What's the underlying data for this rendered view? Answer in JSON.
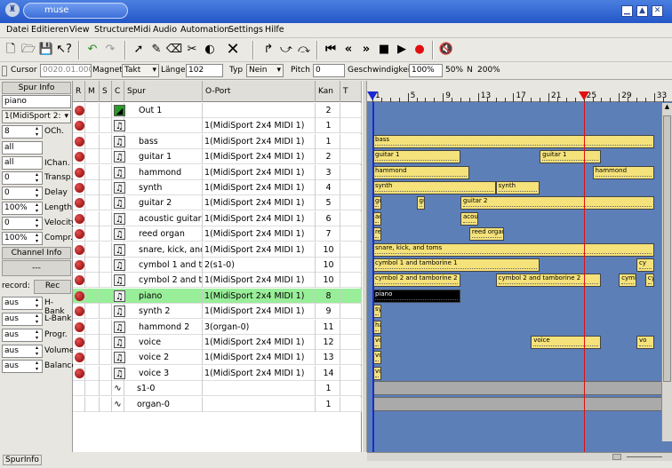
{
  "window": {
    "title": "muse",
    "icon": "muse-icon"
  },
  "menu": [
    "Datei",
    "Editieren",
    "View",
    "Structure",
    "Midi",
    "Audio",
    "Automation",
    "Settings",
    "Hilfe"
  ],
  "toolbar2": {
    "cursor_label": "Cursor",
    "cursor_value": "0020.01.000",
    "magnet_label": "Magnet",
    "magnet_value": "Takt",
    "length_label": "Länge",
    "length_value": "102",
    "type_label": "Typ",
    "type_value": "Nein",
    "pitch_label": "Pitch",
    "pitch_value": "0",
    "speed_label": "Geschwindigkeit",
    "speed_value": "100%",
    "speed_fixed": "50%",
    "n_label": "N",
    "n_value": "200%"
  },
  "left": {
    "spur_info": "Spur Info",
    "track_name": "piano",
    "port": "1(MidiSport 2:",
    "channel": "8",
    "channel_label": "OCh.",
    "input_a": "all",
    "input_b": "all",
    "ichan_label": "IChan.",
    "transp": "0",
    "transp_label": "Transp.",
    "delay": "0",
    "delay_label": "Delay",
    "length": "100%",
    "length_label": "Length",
    "velocity": "0",
    "velocity_label": "Velocity",
    "compr": "100%",
    "compr_label": "Compr.",
    "channel_info": "Channel Info",
    "dashes": "---",
    "record_label": "record:",
    "rec_btn": "Rec",
    "hbank": "aus",
    "hbank_label": "H-Bank",
    "lbank": "aus",
    "lbank_label": "L-Bank",
    "progr": "aus",
    "progr_label": "Progr.",
    "volume": "aus",
    "volume_label": "Volume",
    "balance": "aus",
    "balance_label": "Balance",
    "status": "SpurInfo"
  },
  "tracklist": {
    "headers": [
      "R",
      "M",
      "S",
      "C",
      "Spur",
      "O-Port",
      "Kan",
      "T"
    ],
    "rows": [
      {
        "name": "Out 1",
        "port": "",
        "ch": "2",
        "type": "out"
      },
      {
        "name": "",
        "port": "1(MidiSport 2x4 MIDI 1)",
        "ch": "1",
        "type": "midi"
      },
      {
        "name": "bass",
        "port": "1(MidiSport 2x4 MIDI 1)",
        "ch": "1",
        "type": "midi"
      },
      {
        "name": "guitar 1",
        "port": "1(MidiSport 2x4 MIDI 1)",
        "ch": "2",
        "type": "midi"
      },
      {
        "name": "hammond",
        "port": "1(MidiSport 2x4 MIDI 1)",
        "ch": "3",
        "type": "midi"
      },
      {
        "name": "synth",
        "port": "1(MidiSport 2x4 MIDI 1)",
        "ch": "4",
        "type": "midi"
      },
      {
        "name": "guitar 2",
        "port": "1(MidiSport 2x4 MIDI 1)",
        "ch": "5",
        "type": "midi"
      },
      {
        "name": "acoustic guitar",
        "port": "1(MidiSport 2x4 MIDI 1)",
        "ch": "6",
        "type": "midi"
      },
      {
        "name": "reed organ",
        "port": "1(MidiSport 2x4 MIDI 1)",
        "ch": "7",
        "type": "midi"
      },
      {
        "name": "snare, kick, and t",
        "port": "1(MidiSport 2x4 MIDI 1)",
        "ch": "10",
        "type": "midi"
      },
      {
        "name": "cymbol 1 and tam",
        "port": "2(s1-0)",
        "ch": "10",
        "type": "midi"
      },
      {
        "name": "cymbol 2 and tam",
        "port": "1(MidiSport 2x4 MIDI 1)",
        "ch": "10",
        "type": "midi"
      },
      {
        "name": "piano",
        "port": "1(MidiSport 2x4 MIDI 1)",
        "ch": "8",
        "type": "midi",
        "selected": true
      },
      {
        "name": "synth 2",
        "port": "1(MidiSport 2x4 MIDI 1)",
        "ch": "9",
        "type": "midi"
      },
      {
        "name": "hammond 2",
        "port": "3(organ-0)",
        "ch": "11",
        "type": "midi"
      },
      {
        "name": "voice",
        "port": "1(MidiSport 2x4 MIDI 1)",
        "ch": "12",
        "type": "midi"
      },
      {
        "name": "voice 2",
        "port": "1(MidiSport 2x4 MIDI 1)",
        "ch": "13",
        "type": "midi"
      },
      {
        "name": "voice 3",
        "port": "1(MidiSport 2x4 MIDI 1)",
        "ch": "14",
        "type": "midi"
      },
      {
        "name": "s1-0",
        "port": "",
        "ch": "1",
        "type": "synth"
      },
      {
        "name": "organ-0",
        "port": "",
        "ch": "1",
        "type": "synth"
      }
    ]
  },
  "ruler": [
    "1",
    "5",
    "9",
    "13",
    "17",
    "21",
    "25",
    "29",
    "33"
  ],
  "parts": [
    {
      "lane": 2,
      "from": 0,
      "to": 32,
      "label": "bass"
    },
    {
      "lane": 3,
      "from": 0,
      "to": 10,
      "label": "guitar 1"
    },
    {
      "lane": 3,
      "from": 19,
      "to": 26,
      "label": "guitar 1"
    },
    {
      "lane": 4,
      "from": 0,
      "to": 11,
      "label": "hammond"
    },
    {
      "lane": 4,
      "from": 25,
      "to": 32,
      "label": "hammond"
    },
    {
      "lane": 5,
      "from": 0,
      "to": 14,
      "label": "synth"
    },
    {
      "lane": 5,
      "from": 14,
      "to": 19,
      "label": "synth"
    },
    {
      "lane": 6,
      "from": 0,
      "to": 1,
      "label": "gu"
    },
    {
      "lane": 6,
      "from": 5,
      "to": 6,
      "label": "gu"
    },
    {
      "lane": 6,
      "from": 10,
      "to": 32,
      "label": "guitar 2"
    },
    {
      "lane": 7,
      "from": 0,
      "to": 1,
      "label": "ac"
    },
    {
      "lane": 7,
      "from": 10,
      "to": 12,
      "label": "acous"
    },
    {
      "lane": 8,
      "from": 0,
      "to": 1,
      "label": "re"
    },
    {
      "lane": 8,
      "from": 11,
      "to": 15,
      "label": "reed organ"
    },
    {
      "lane": 9,
      "from": 0,
      "to": 32,
      "label": "snare, kick, and toms"
    },
    {
      "lane": 10,
      "from": 0,
      "to": 19,
      "label": "cymbol 1 and tamborine 1"
    },
    {
      "lane": 10,
      "from": 30,
      "to": 32,
      "label": "cy"
    },
    {
      "lane": 11,
      "from": 0,
      "to": 10,
      "label": "cymbol 2 and tamborine 2"
    },
    {
      "lane": 11,
      "from": 14,
      "to": 26,
      "label": "cymbol 2 and tamborine 2"
    },
    {
      "lane": 11,
      "from": 28,
      "to": 30,
      "label": "cymb"
    },
    {
      "lane": 11,
      "from": 31,
      "to": 32,
      "label": "cy"
    },
    {
      "lane": 12,
      "from": 0,
      "to": 10,
      "label": "piano",
      "dark": true
    },
    {
      "lane": 13,
      "from": 0,
      "to": 1,
      "label": "sy"
    },
    {
      "lane": 14,
      "from": 0,
      "to": 1,
      "label": "ha"
    },
    {
      "lane": 15,
      "from": 0,
      "to": 1,
      "label": "vo"
    },
    {
      "lane": 15,
      "from": 18,
      "to": 26,
      "label": "voice"
    },
    {
      "lane": 15,
      "from": 30,
      "to": 32,
      "label": "vo"
    },
    {
      "lane": 16,
      "from": 0,
      "to": 1,
      "label": "vo"
    },
    {
      "lane": 17,
      "from": 0,
      "to": 1,
      "label": "vo"
    }
  ],
  "playhead_bar": 25
}
